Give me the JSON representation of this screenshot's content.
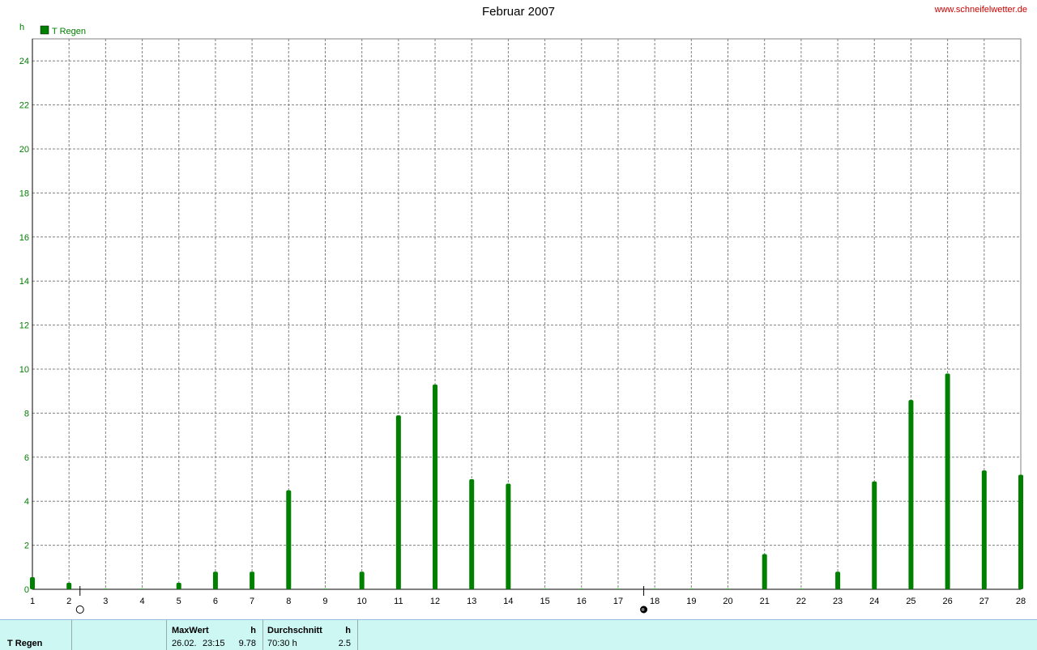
{
  "title": "Februar 2007",
  "site": "www.schneifelwetter.de",
  "colors": {
    "series": "#008000",
    "grid": "#808080",
    "site": "#cc0000",
    "footer_bg": "#ccf7f3"
  },
  "chart_data": {
    "type": "bar",
    "ylabel": "h",
    "ylim": [
      0,
      25
    ],
    "yticks": [
      "0",
      "2",
      "4",
      "6",
      "8",
      "10",
      "12",
      "14",
      "16",
      "18",
      "20",
      "22",
      "24"
    ],
    "xlim": [
      1,
      28
    ],
    "xticks": [
      "1",
      "2",
      "3",
      "4",
      "5",
      "6",
      "7",
      "8",
      "9",
      "10",
      "11",
      "12",
      "13",
      "14",
      "15",
      "16",
      "17",
      "18",
      "19",
      "20",
      "21",
      "22",
      "23",
      "24",
      "25",
      "26",
      "27",
      "28"
    ],
    "grid": true,
    "legend_position": "top-left",
    "series": [
      {
        "name": "T Regen",
        "color": "#008000",
        "points": [
          {
            "x": 1,
            "y": 0.55
          },
          {
            "x": 2,
            "y": 0.3
          },
          {
            "x": 3,
            "y": 0.0
          },
          {
            "x": 4,
            "y": 0.02
          },
          {
            "x": 5,
            "y": 0.3
          },
          {
            "x": 6,
            "y": 0.8
          },
          {
            "x": 7,
            "y": 0.8
          },
          {
            "x": 8,
            "y": 4.5
          },
          {
            "x": 9,
            "y": 0.0
          },
          {
            "x": 10,
            "y": 0.8
          },
          {
            "x": 11,
            "y": 7.9
          },
          {
            "x": 12,
            "y": 9.3
          },
          {
            "x": 13,
            "y": 5.0
          },
          {
            "x": 14,
            "y": 4.8
          },
          {
            "x": 15,
            "y": 0.0
          },
          {
            "x": 16,
            "y": 0.0
          },
          {
            "x": 17,
            "y": 0.0
          },
          {
            "x": 18,
            "y": 0.0
          },
          {
            "x": 19,
            "y": 0.0
          },
          {
            "x": 20,
            "y": 0.0
          },
          {
            "x": 21,
            "y": 1.6
          },
          {
            "x": 22,
            "y": 0.0
          },
          {
            "x": 23,
            "y": 0.8
          },
          {
            "x": 24,
            "y": 4.9
          },
          {
            "x": 25,
            "y": 8.6
          },
          {
            "x": 26,
            "y": 9.8
          },
          {
            "x": 27,
            "y": 5.4
          },
          {
            "x": 28,
            "y": 5.2
          }
        ]
      }
    ],
    "moon_phases": [
      {
        "x": 2.3,
        "phase": "full-moon"
      },
      {
        "x": 17.7,
        "phase": "new-moon"
      }
    ]
  },
  "footer": {
    "series_label": "T Regen",
    "max_header": "MaxWert",
    "max_unit": "h",
    "max_date": "26.02.",
    "max_time": "23:15",
    "max_value": "9.78",
    "avg_header": "Durchschnitt",
    "avg_unit": "h",
    "avg_total": "70:30 h",
    "avg_value": "2.5"
  }
}
